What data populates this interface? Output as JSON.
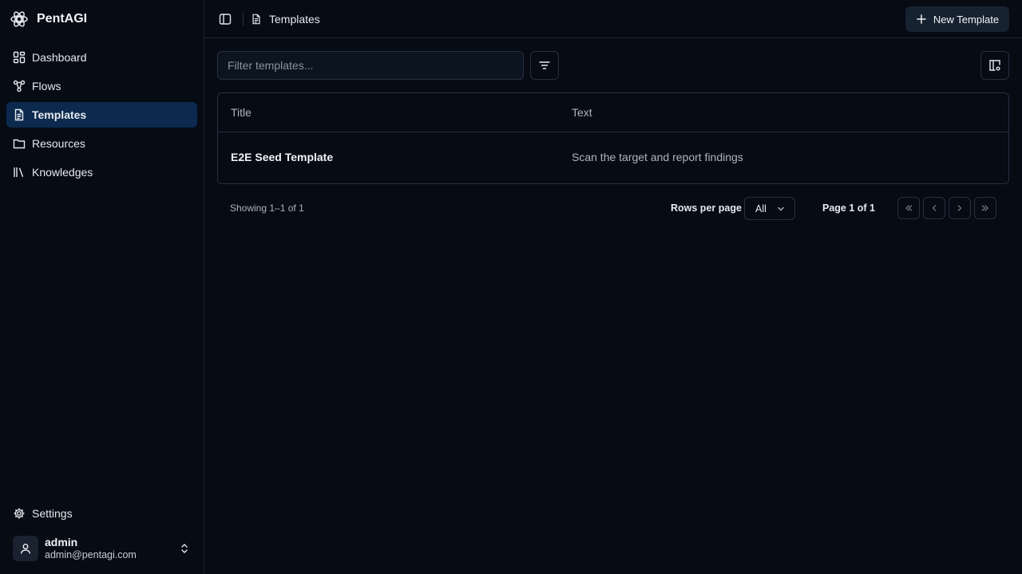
{
  "app": {
    "name": "PentAGI",
    "logo_icon": "atom-network-icon"
  },
  "sidebar": {
    "items": [
      {
        "label": "Dashboard",
        "icon": "dashboard-grid-icon",
        "active": false
      },
      {
        "label": "Flows",
        "icon": "workflow-icon",
        "active": false
      },
      {
        "label": "Templates",
        "icon": "document-icon",
        "active": true
      },
      {
        "label": "Resources",
        "icon": "folder-icon",
        "active": false
      },
      {
        "label": "Knowledges",
        "icon": "library-icon",
        "active": false
      }
    ],
    "settings_label": "Settings",
    "user": {
      "name": "admin",
      "email": "admin@pentagi.com"
    }
  },
  "header": {
    "breadcrumb": "Templates",
    "new_button_label": "New Template"
  },
  "toolbar": {
    "filter_placeholder": "Filter templates..."
  },
  "table": {
    "columns": [
      "Title",
      "Text"
    ],
    "rows": [
      {
        "title": "E2E Seed Template",
        "text": "Scan the target and report findings"
      }
    ]
  },
  "pagination": {
    "showing": "Showing 1–1 of 1",
    "rows_per_page_label": "Rows per page",
    "rows_per_page_value": "All",
    "page_label": "Page 1 of 1"
  },
  "colors": {
    "background": "#060b14",
    "active_nav": "#0b2a4e",
    "primary_button": "#172231",
    "border": "#263142"
  }
}
